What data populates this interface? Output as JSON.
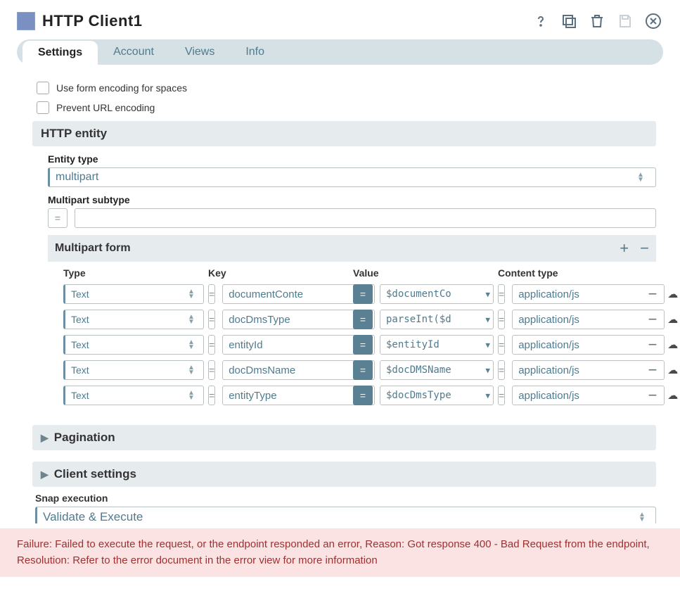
{
  "title": "HTTP Client1",
  "tabs": [
    "Settings",
    "Account",
    "Views",
    "Info"
  ],
  "active_tab": 0,
  "checkboxes": {
    "use_form_encoding": "Use form encoding for spaces",
    "prevent_url_encoding": "Prevent URL encoding"
  },
  "http_entity": {
    "heading": "HTTP entity",
    "entity_type_label": "Entity type",
    "entity_type_value": "multipart",
    "multipart_subtype_label": "Multipart subtype",
    "multipart_subtype_value": "",
    "multipart_form_heading": "Multipart form",
    "columns": {
      "type": "Type",
      "key": "Key",
      "value": "Value",
      "content_type": "Content type"
    },
    "rows": [
      {
        "type": "Text",
        "key": "documentConte",
        "value": "$documentCo",
        "content_type": "application/js"
      },
      {
        "type": "Text",
        "key": "docDmsType",
        "value": "parseInt($d",
        "content_type": "application/js"
      },
      {
        "type": "Text",
        "key": "entityId",
        "value": "$entityId",
        "content_type": "application/js"
      },
      {
        "type": "Text",
        "key": "docDmsName",
        "value": "$docDMSName",
        "content_type": "application/js"
      },
      {
        "type": "Text",
        "key": "entityType",
        "value": "$docDmsType",
        "content_type": "application/js"
      }
    ]
  },
  "collapsed_sections": {
    "pagination": "Pagination",
    "client_settings": "Client settings"
  },
  "snap_execution": {
    "label": "Snap execution",
    "value": "Validate & Execute"
  },
  "error_message": "Failure: Failed to execute the request, or the endpoint responded an error, Reason: Got response 400 - Bad Request from the endpoint, Resolution: Refer to the error document in the error view for more information"
}
